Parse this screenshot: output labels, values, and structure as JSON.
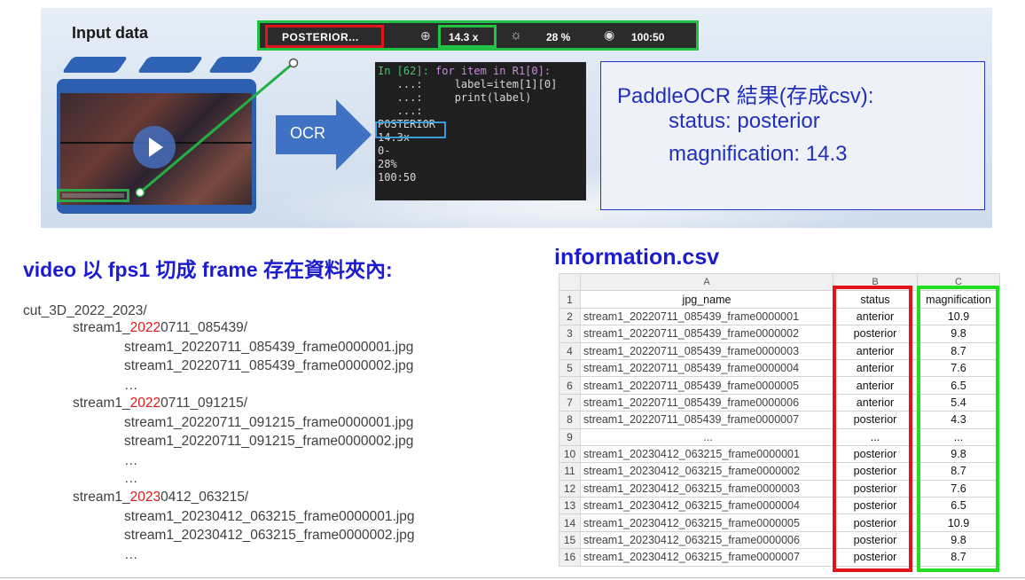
{
  "banner": {
    "input_title": "Input data",
    "toolbar": {
      "posterior_label": "POSTERIOR...",
      "zoom_value": "14.3 x",
      "brightness_value": "28 %",
      "time_value": "100:50",
      "icons": [
        "zoom-icon",
        "brightness-icon",
        "eye-icon"
      ]
    },
    "ocr_label": "OCR",
    "code": {
      "line1_prompt": "In [62]: ",
      "line1_code": "for item in R1[0]:",
      "line2": "   ...:     label=item[1][0]",
      "line3": "   ...:     print(label)",
      "line4": "   ...:",
      "out1": "POSTERIOR",
      "out2": "14.3x",
      "out3": "0-",
      "out4": "28%",
      "out5": "100:50"
    },
    "result": {
      "title": "PaddleOCR 結果(存成csv):",
      "status_line": "status: posterior",
      "magnification_line": "magnification: 14.3"
    }
  },
  "left": {
    "title": "video 以 fps1 切成 frame 存在資料夾內:",
    "root": "cut_3D_2022_2023/",
    "folder1": {
      "pre": "stream1_",
      "year": "2022",
      "post": "0711_085439/"
    },
    "f1_files": [
      "stream1_20220711_085439_frame0000001.jpg",
      "stream1_20220711_085439_frame0000002.jpg",
      "…"
    ],
    "folder2": {
      "pre": "stream1_",
      "year": "2022",
      "post": "0711_091215/"
    },
    "f2_files": [
      "stream1_20220711_091215_frame0000001.jpg",
      "stream1_20220711_091215_frame0000002.jpg",
      "…",
      "…"
    ],
    "folder3": {
      "pre": "stream1_",
      "year": "2023",
      "post": "0412_063215/"
    },
    "f3_files": [
      "stream1_20230412_063215_frame0000001.jpg",
      "stream1_20230412_063215_frame0000002.jpg",
      "…"
    ]
  },
  "csv": {
    "title": "information.csv",
    "col_letters": [
      "A",
      "B",
      "C"
    ],
    "headers": [
      "jpg_name",
      "status",
      "magnification"
    ],
    "rows": [
      [
        "2",
        "stream1_20220711_085439_frame0000001",
        "anterior",
        "10.9"
      ],
      [
        "3",
        "stream1_20220711_085439_frame0000002",
        "posterior",
        "9.8"
      ],
      [
        "4",
        "stream1_20220711_085439_frame0000003",
        "anterior",
        "8.7"
      ],
      [
        "5",
        "stream1_20220711_085439_frame0000004",
        "anterior",
        "7.6"
      ],
      [
        "6",
        "stream1_20220711_085439_frame0000005",
        "anterior",
        "6.5"
      ],
      [
        "7",
        "stream1_20220711_085439_frame0000006",
        "anterior",
        "5.4"
      ],
      [
        "8",
        "stream1_20220711_085439_frame0000007",
        "posterior",
        "4.3"
      ],
      [
        "9",
        "...",
        "...",
        "..."
      ],
      [
        "10",
        "stream1_20230412_063215_frame0000001",
        "posterior",
        "9.8"
      ],
      [
        "11",
        "stream1_20230412_063215_frame0000002",
        "posterior",
        "8.7"
      ],
      [
        "12",
        "stream1_20230412_063215_frame0000003",
        "posterior",
        "7.6"
      ],
      [
        "13",
        "stream1_20230412_063215_frame0000004",
        "posterior",
        "6.5"
      ],
      [
        "14",
        "stream1_20230412_063215_frame0000005",
        "posterior",
        "10.9"
      ],
      [
        "15",
        "stream1_20230412_063215_frame0000006",
        "posterior",
        "9.8"
      ],
      [
        "16",
        "stream1_20230412_063215_frame0000007",
        "posterior",
        "8.7"
      ]
    ],
    "header_row_number": "1"
  },
  "colors": {
    "title_blue": "#1c1ccf",
    "highlight_red": "#e0141a",
    "highlight_green": "#22c043"
  }
}
